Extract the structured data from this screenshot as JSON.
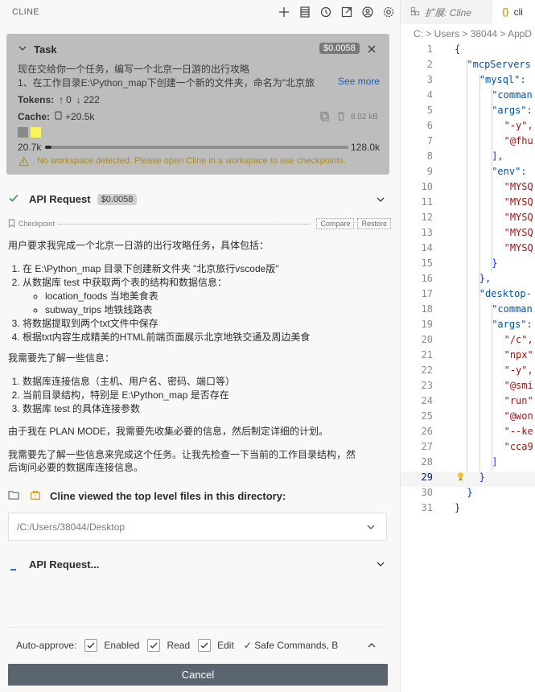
{
  "sidebar": {
    "title": "CLINE",
    "icons": [
      "plus-icon",
      "history-list-icon",
      "history-icon",
      "popout-icon",
      "account-icon",
      "gear-icon"
    ]
  },
  "task": {
    "label": "Task",
    "cost": "$0.0058",
    "line1": "现在交给你一个任务，编写一个北京一日游的出行攻略",
    "line2": "1、在工作目录E:\\Python_map下创建一个新的文件夹，命名为\"北京旅",
    "see_more": "See more",
    "tokens_label": "Tokens:",
    "tokens_up": "0",
    "tokens_down": "222",
    "cache_label": "Cache:",
    "cache_value": "+20.5k",
    "size": "8.02 kB",
    "context_used": "20.7k",
    "context_max": "128.0k",
    "context_fraction": 0.02,
    "warning": "No workspace detected. Please open Cline in a workspace to use checkpoints."
  },
  "api_request": {
    "label": "API Request",
    "cost": "$0.0058"
  },
  "checkpoint": {
    "label": "Checkpoint",
    "compare": "Compare",
    "restore": "Restore"
  },
  "message": {
    "intro": "用户要求我完成一个北京一日游的出行攻略任务，具体包括：",
    "steps": [
      "在 E:\\Python_map 目录下创建新文件夹 \"北京旅行vscode版\"",
      "从数据库 test 中获取两个表的结构和数据信息：",
      "将数据提取到两个txt文件中保存",
      "根据txt内容生成精美的HTML前端页面展示北京地铁交通及周边美食"
    ],
    "sub_items": [
      "location_foods 当地美食表",
      "subway_trips 地铁线路表"
    ],
    "need_info": "我需要先了解一些信息：",
    "info_items": [
      "数据库连接信息（主机、用户名、密码、端口等）",
      "当前目录结构，特别是 E:\\Python_map 是否存在",
      "数据库 test 的具体连接参数"
    ],
    "plan_mode": "由于我在 PLAN MODE，我需要先收集必要的信息，然后制定详细的计划。",
    "next1": "我需要先了解一些信息来完成这个任务。让我先检查一下当前的工作目录结构，然",
    "next2": "后询问必要的数据库连接信息。"
  },
  "viewed": {
    "label": "Cline viewed the top level files in this directory:",
    "path": "/C:/Users/38044/Desktop"
  },
  "api_request_pending": {
    "label": "API Request..."
  },
  "auto_approve": {
    "label": "Auto-approve:",
    "enabled": "Enabled",
    "read": "Read",
    "edit": "Edit",
    "safe": "✓ Safe Commands, B"
  },
  "cancel_label": "Cancel",
  "editor": {
    "tab1": "扩展: Cline",
    "tab2": "cli",
    "breadcrumb": "C: > Users > 38044 > AppD",
    "lines": [
      {
        "n": "1",
        "t": "{"
      },
      {
        "n": "2",
        "t": "  \"mcpServers"
      },
      {
        "n": "3",
        "t": "    \"mysql\":"
      },
      {
        "n": "4",
        "t": "      \"comman"
      },
      {
        "n": "5",
        "t": "      \"args\":"
      },
      {
        "n": "6",
        "t": "        \"-y\","
      },
      {
        "n": "7",
        "t": "        \"@fhu"
      },
      {
        "n": "8",
        "t": "      ],"
      },
      {
        "n": "9",
        "t": "      \"env\":"
      },
      {
        "n": "10",
        "t": "        \"MYSQ"
      },
      {
        "n": "11",
        "t": "        \"MYSQ"
      },
      {
        "n": "12",
        "t": "        \"MYSQ"
      },
      {
        "n": "13",
        "t": "        \"MYSQ"
      },
      {
        "n": "14",
        "t": "        \"MYSQ"
      },
      {
        "n": "15",
        "t": "      }"
      },
      {
        "n": "16",
        "t": "    },"
      },
      {
        "n": "17",
        "t": "    \"desktop-"
      },
      {
        "n": "18",
        "t": "      \"comman"
      },
      {
        "n": "19",
        "t": "      \"args\":"
      },
      {
        "n": "20",
        "t": "        \"/c\","
      },
      {
        "n": "21",
        "t": "        \"npx\""
      },
      {
        "n": "22",
        "t": "        \"-y\","
      },
      {
        "n": "23",
        "t": "        \"@smi"
      },
      {
        "n": "24",
        "t": "        \"run\""
      },
      {
        "n": "25",
        "t": "        \"@won"
      },
      {
        "n": "26",
        "t": "        \"--ke"
      },
      {
        "n": "27",
        "t": "        \"cca9"
      },
      {
        "n": "28",
        "t": "      ]"
      },
      {
        "n": "29",
        "t": "    }"
      },
      {
        "n": "30",
        "t": "  }"
      },
      {
        "n": "31",
        "t": "}"
      }
    ]
  }
}
